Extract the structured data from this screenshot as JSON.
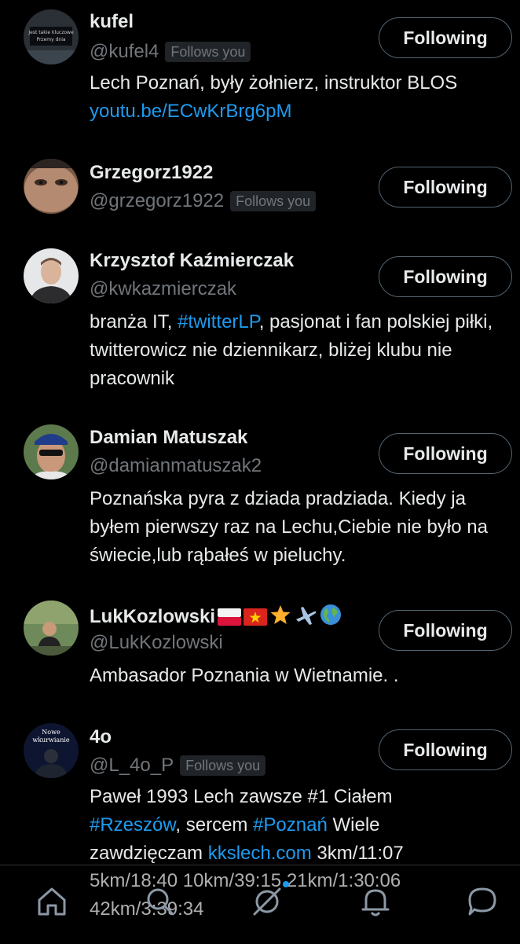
{
  "users": [
    {
      "name": "kufel",
      "handle": "@kufel4",
      "follows_you": "Follows you",
      "button": "Following",
      "bio_text": "Lech Poznań, były żołnierz, instruktor BLOS",
      "bio_link": "youtu.be/ECwKrBrg6pM",
      "avatar_text_1": "Jest takie kluczowe",
      "avatar_text_2": "Przemy dnia"
    },
    {
      "name": "Grzegorz1922",
      "handle": "@grzegorz1922",
      "follows_you": "Follows you",
      "button": "Following"
    },
    {
      "name": "Krzysztof Kaźmierczak",
      "handle": "@kwkazmierczak",
      "button": "Following",
      "bio_1": "branża IT, ",
      "bio_hashtag": "#twitterLP",
      "bio_2": ", pasjonat i fan polskiej piłki, twitterowicz nie dziennikarz, bliżej klubu nie pracownik"
    },
    {
      "name": "Damian Matuszak",
      "handle": "@damianmatuszak2",
      "button": "Following",
      "bio": "Poznańska pyra z dziada pradziada. Kiedy ja byłem pierwszy raz na Lechu,Ciebie nie było na świecie,lub rąbałeś w pieluchy."
    },
    {
      "name": "LukKozlowski",
      "handle": "@LukKozlowski",
      "button": "Following",
      "bio": "Ambasador Poznania w Wietnamie. .",
      "name_emoji_icons": [
        "poland-flag-icon",
        "vietnam-flag-icon",
        "star-icon",
        "airplane-icon",
        "globe-icon"
      ]
    },
    {
      "name": "4o",
      "handle": "@L_4o_P",
      "follows_you": "Follows you",
      "button": "Following",
      "bio_a": "Paweł 1993 Lech zawsze #1 Ciałem",
      "bio_hashtag_1": "#Rzeszów",
      "bio_b": ", sercem ",
      "bio_hashtag_2": "#Poznań",
      "bio_c": " Wiele",
      "bio_d": "zawdzięczam ",
      "bio_link": "kkslech.com",
      "bio_e": " 3km/11:07",
      "bio_f": "5km/18:40 10km/39:15 21km/1:30:06",
      "bio_g": "42km/3:39:34",
      "avatar_text_1": "Nowe",
      "avatar_text_2": "wkurwianie"
    }
  ],
  "nav": {
    "items": [
      "home-icon",
      "search-icon",
      "grok-icon",
      "notifications-icon",
      "messages-icon"
    ]
  },
  "colors": {
    "background": "#000000",
    "link": "#1d9bf0",
    "secondary_text": "#71767b",
    "button_border": "#536471"
  }
}
